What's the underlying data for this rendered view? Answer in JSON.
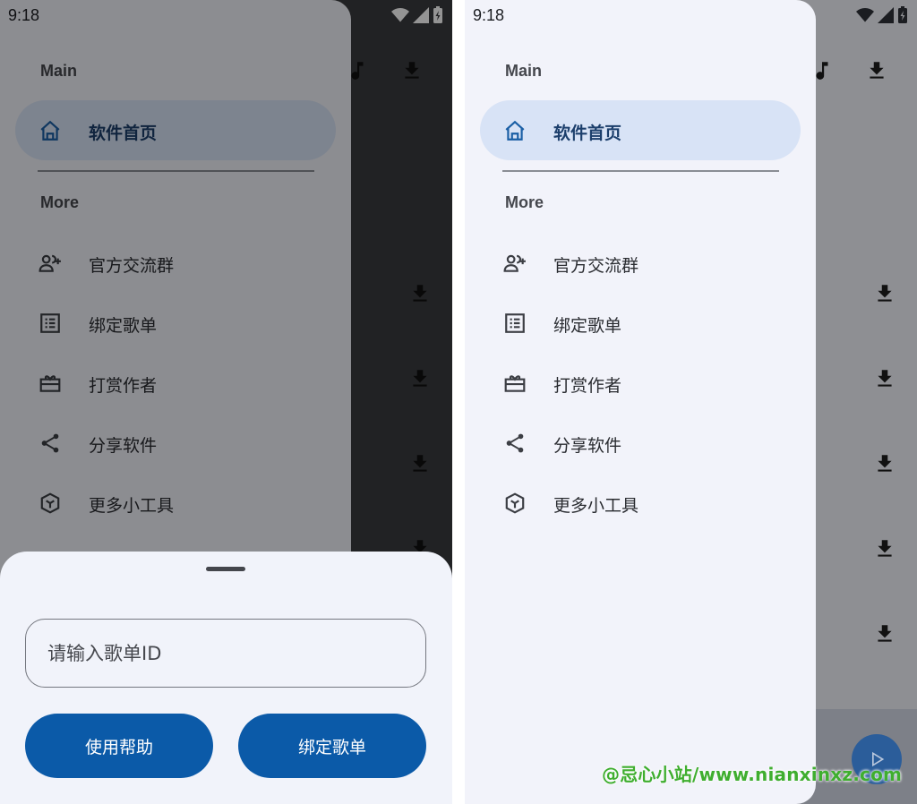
{
  "status_bar": {
    "time": "9:18"
  },
  "drawer": {
    "section_main": "Main",
    "section_more": "More",
    "main_items": [
      {
        "label": "软件首页",
        "icon": "home-icon",
        "active": true
      }
    ],
    "more_items": [
      {
        "label": "官方交流群",
        "icon": "group-add-icon"
      },
      {
        "label": "绑定歌单",
        "icon": "list-icon"
      },
      {
        "label": "打赏作者",
        "icon": "gift-icon"
      },
      {
        "label": "分享软件",
        "icon": "share-icon"
      },
      {
        "label": "更多小工具",
        "icon": "toolbox-icon"
      }
    ]
  },
  "bottom_sheet": {
    "input_placeholder": "请输入歌单ID",
    "help_button": "使用帮助",
    "bind_button": "绑定歌单"
  },
  "watermark": "@忌心小站/www.nianxinxz.com",
  "colors": {
    "drawer_bg": "#f2f3fa",
    "active_item_bg": "#d8e3f6",
    "button_bg": "#0b5aa8",
    "watermark": "#3fae2f"
  }
}
